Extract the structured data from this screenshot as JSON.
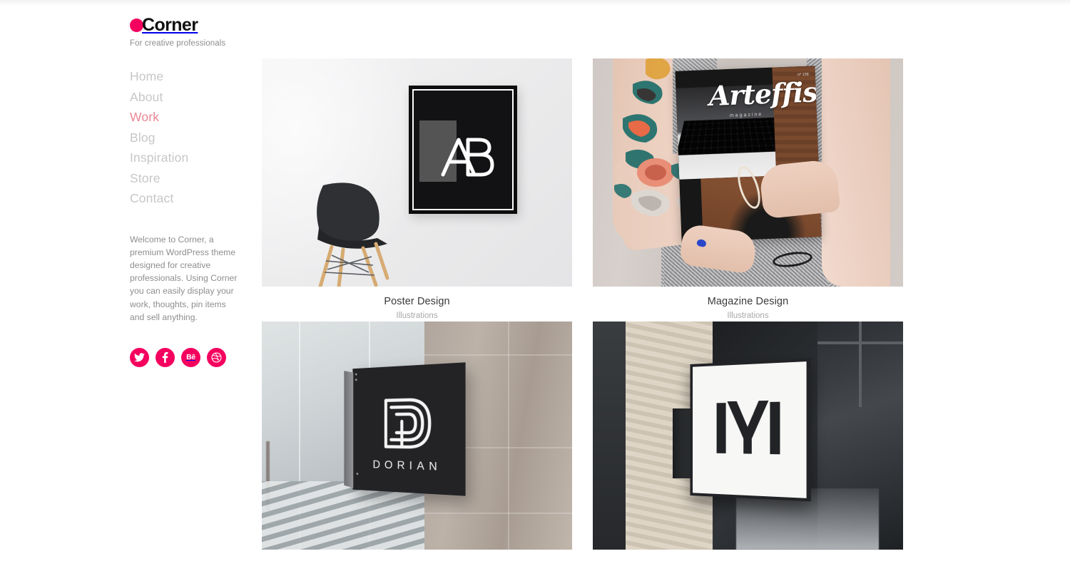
{
  "brand": {
    "name": "Corner",
    "tagline": "For creative professionals",
    "dot_icon": "circle-dot-icon",
    "accent_color": "#f4005e"
  },
  "nav": {
    "items": [
      {
        "label": "Home",
        "active": false
      },
      {
        "label": "About",
        "active": false
      },
      {
        "label": "Work",
        "active": true
      },
      {
        "label": "Blog",
        "active": false
      },
      {
        "label": "Inspiration",
        "active": false
      },
      {
        "label": "Store",
        "active": false
      },
      {
        "label": "Contact",
        "active": false
      }
    ],
    "active_color": "#e98693",
    "inactive_color": "#c7c7c7"
  },
  "intro": {
    "text": "Welcome to Corner, a premium WordPress theme designed for creative professionals. Using Corner you can easily display your work, thoughts, pin items and sell anything."
  },
  "socials": [
    {
      "name": "twitter-icon",
      "label": "Twitter"
    },
    {
      "name": "facebook-icon",
      "label": "Facebook"
    },
    {
      "name": "behance-icon",
      "label": "Behance",
      "glyph": "Bē"
    },
    {
      "name": "dribbble-icon",
      "label": "Dribbble"
    }
  ],
  "portfolio": {
    "items": [
      {
        "title": "Poster Design",
        "category": "Illustrations",
        "artwork": "poster-mockup",
        "artwork_text": {
          "monogram": "AB"
        }
      },
      {
        "title": "Magazine Design",
        "category": "Illustrations",
        "artwork": "magazine-mockup",
        "artwork_text": {
          "cover_title": "Arteffis",
          "cover_sub": "magazine",
          "issue": "nº 158"
        }
      },
      {
        "title": "",
        "category": "",
        "artwork": "dorian-sign-mockup",
        "artwork_text": {
          "sign_text": "DORIAN"
        }
      },
      {
        "title": "",
        "category": "",
        "artwork": "m-lightbox-sign-mockup",
        "artwork_text": {
          "monogram": "M"
        }
      }
    ]
  }
}
